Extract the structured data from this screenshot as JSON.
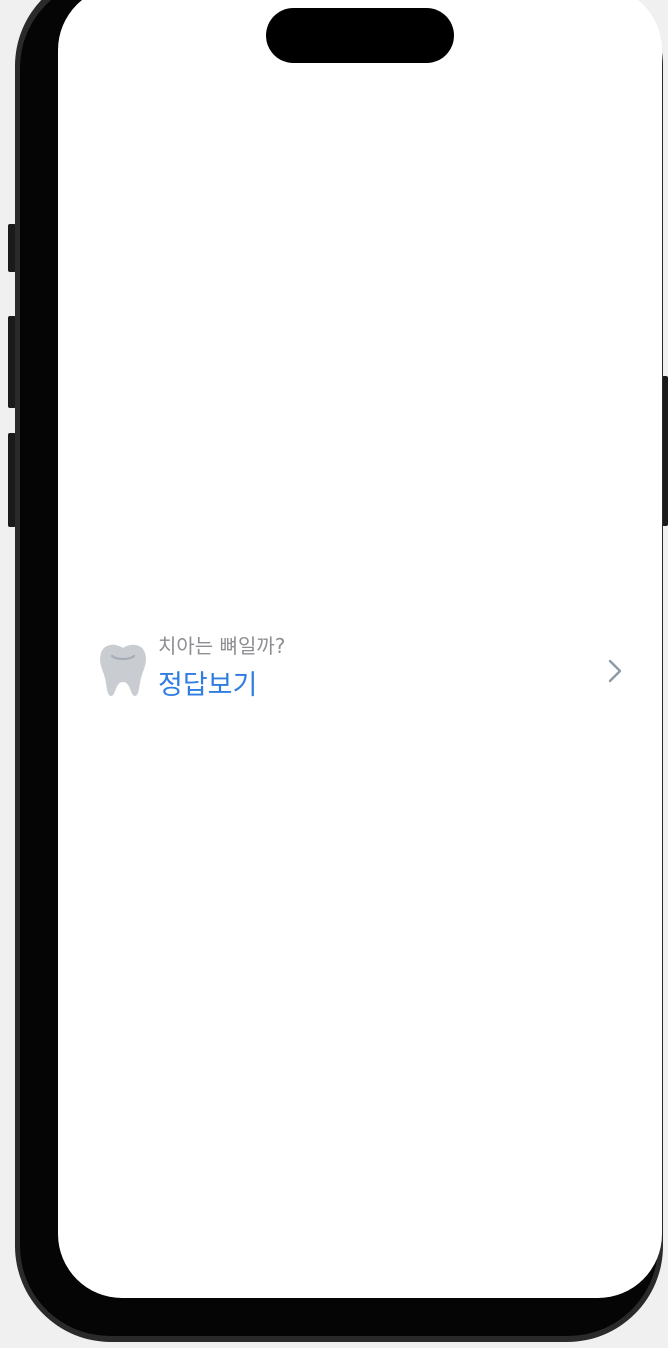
{
  "quiz": {
    "question": "치아는 뼈일까?",
    "action_label": "정답보기",
    "icon": "tooth-icon",
    "trailing_icon": "chevron-right-icon"
  },
  "colors": {
    "question_text": "#8e8e93",
    "link_accent": "#2f7de0",
    "icon_gray": "#c9ccd1",
    "chevron_gray": "#8f9aa8"
  }
}
